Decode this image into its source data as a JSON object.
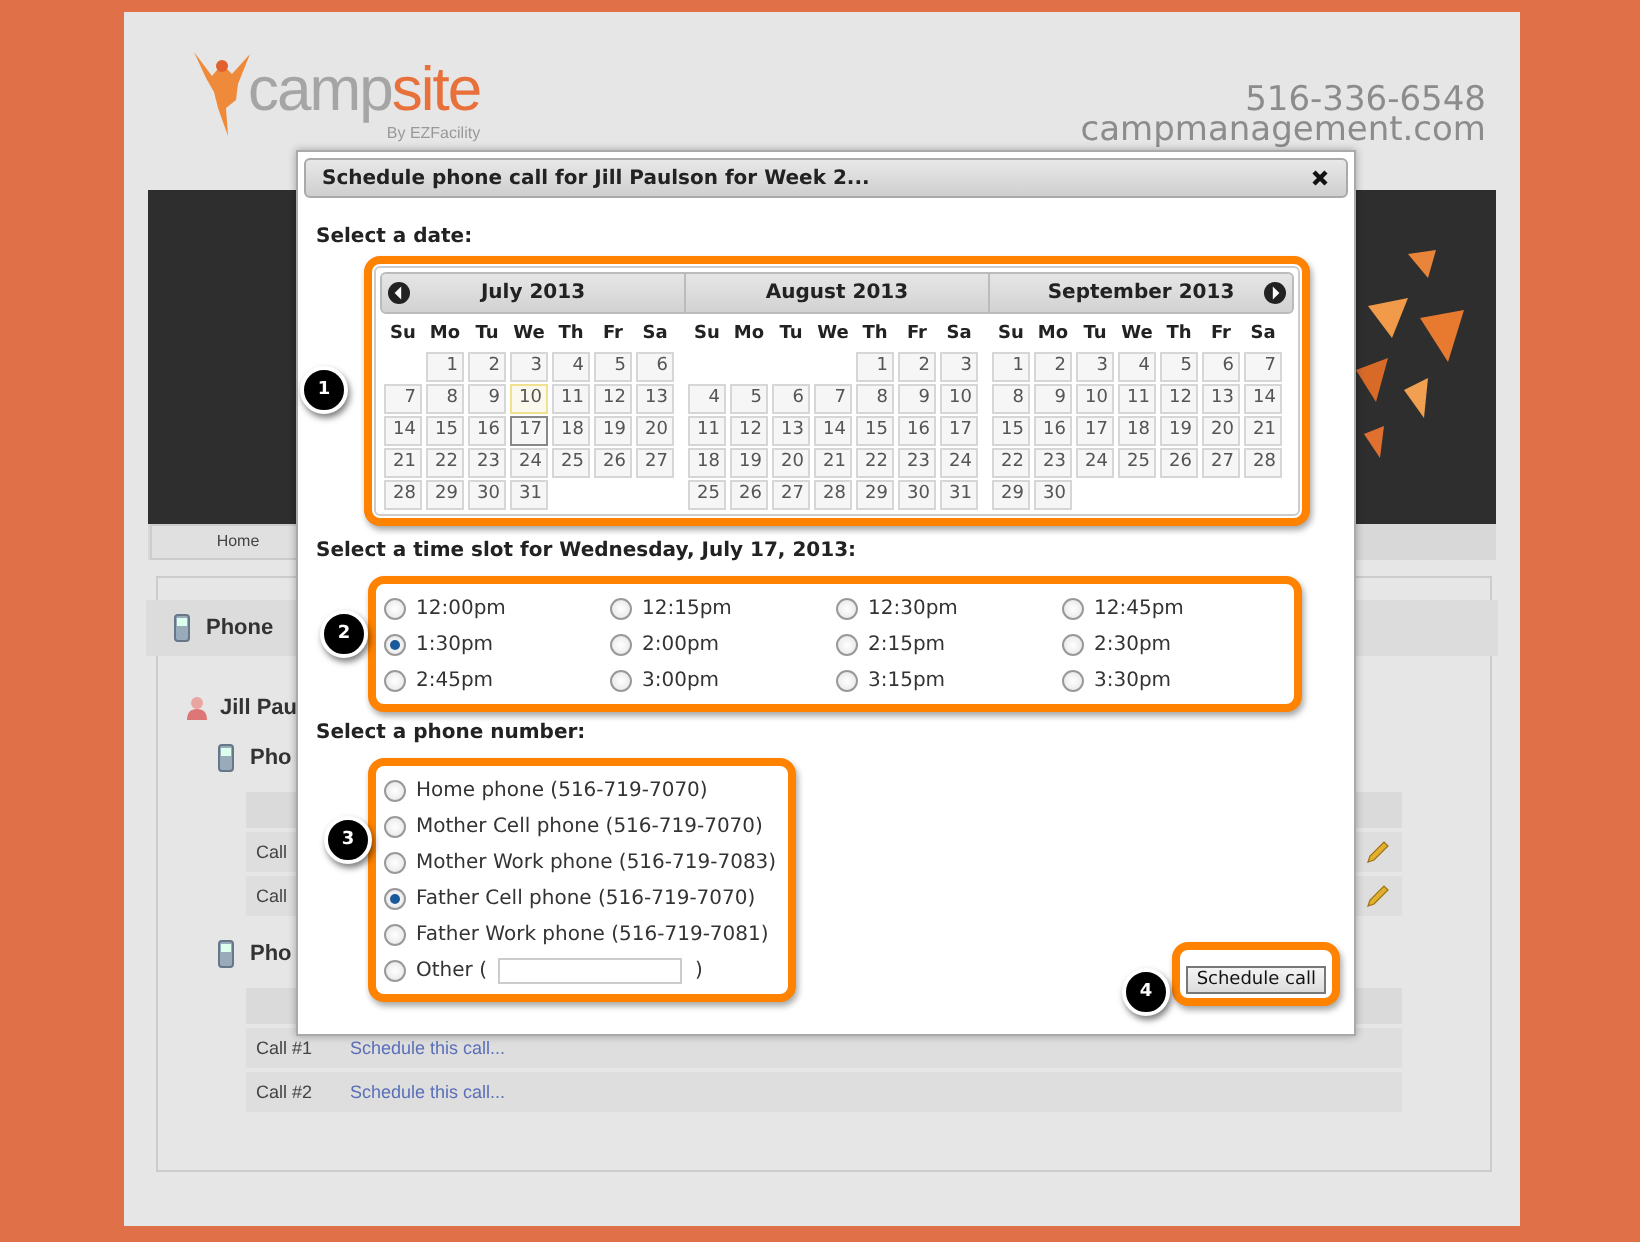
{
  "header": {
    "logo_text": "camp",
    "logo_accent": "site",
    "logo_byline": "By EZFacility",
    "phone": "516-336-6548",
    "website": "campmanagement.com"
  },
  "nav": {
    "item": "Home"
  },
  "background": {
    "section_title": "Phone",
    "person": "Jill Pau",
    "groups": [
      {
        "title": "Pho",
        "rows": [
          {
            "label": "Call",
            "editable": true
          },
          {
            "label": "Call",
            "editable": true
          }
        ]
      },
      {
        "title": "Pho",
        "rows": [
          {
            "label": "Call #1",
            "link": "Schedule this call...",
            "editable": false
          },
          {
            "label": "Call #2",
            "link": "Schedule this call...",
            "editable": false
          }
        ]
      }
    ]
  },
  "dialog": {
    "title": "Schedule phone call for Jill Paulson for Week 2...",
    "date_label": "Select a date:",
    "months": [
      {
        "title": "July 2013",
        "prev_button": true,
        "next_button": false,
        "weekdays": [
          "Su",
          "Mo",
          "Tu",
          "We",
          "Th",
          "Fr",
          "Sa"
        ],
        "weeks": [
          [
            {
              "kind": "blank"
            },
            {
              "kind": "day",
              "label": "1",
              "selected": false,
              "today": false
            },
            {
              "kind": "day",
              "label": "2",
              "selected": false,
              "today": false
            },
            {
              "kind": "day",
              "label": "3",
              "selected": false,
              "today": false
            },
            {
              "kind": "day",
              "label": "4",
              "selected": false,
              "today": false
            },
            {
              "kind": "day",
              "label": "5",
              "selected": false,
              "today": false
            },
            {
              "kind": "day",
              "label": "6",
              "selected": false,
              "today": false
            }
          ],
          [
            {
              "kind": "day",
              "label": "7",
              "selected": false,
              "today": false
            },
            {
              "kind": "day",
              "label": "8",
              "selected": false,
              "today": false
            },
            {
              "kind": "day",
              "label": "9",
              "selected": false,
              "today": false
            },
            {
              "kind": "day",
              "label": "10",
              "selected": false,
              "today": true
            },
            {
              "kind": "day",
              "label": "11",
              "selected": false,
              "today": false
            },
            {
              "kind": "day",
              "label": "12",
              "selected": false,
              "today": false
            },
            {
              "kind": "day",
              "label": "13",
              "selected": false,
              "today": false
            }
          ],
          [
            {
              "kind": "day",
              "label": "14",
              "selected": false,
              "today": false
            },
            {
              "kind": "day",
              "label": "15",
              "selected": false,
              "today": false
            },
            {
              "kind": "day",
              "label": "16",
              "selected": false,
              "today": false
            },
            {
              "kind": "day",
              "label": "17",
              "selected": true,
              "today": false
            },
            {
              "kind": "day",
              "label": "18",
              "selected": false,
              "today": false
            },
            {
              "kind": "day",
              "label": "19",
              "selected": false,
              "today": false
            },
            {
              "kind": "day",
              "label": "20",
              "selected": false,
              "today": false
            }
          ],
          [
            {
              "kind": "day",
              "label": "21",
              "selected": false,
              "today": false
            },
            {
              "kind": "day",
              "label": "22",
              "selected": false,
              "today": false
            },
            {
              "kind": "day",
              "label": "23",
              "selected": false,
              "today": false
            },
            {
              "kind": "day",
              "label": "24",
              "selected": false,
              "today": false
            },
            {
              "kind": "day",
              "label": "25",
              "selected": false,
              "today": false
            },
            {
              "kind": "day",
              "label": "26",
              "selected": false,
              "today": false
            },
            {
              "kind": "day",
              "label": "27",
              "selected": false,
              "today": false
            }
          ],
          [
            {
              "kind": "day",
              "label": "28",
              "selected": false,
              "today": false
            },
            {
              "kind": "day",
              "label": "29",
              "selected": false,
              "today": false
            },
            {
              "kind": "day",
              "label": "30",
              "selected": false,
              "today": false
            },
            {
              "kind": "day",
              "label": "31",
              "selected": false,
              "today": false
            }
          ]
        ]
      },
      {
        "title": "August 2013",
        "prev_button": false,
        "next_button": false,
        "weekdays": [
          "Su",
          "Mo",
          "Tu",
          "We",
          "Th",
          "Fr",
          "Sa"
        ],
        "weeks": [
          [
            {
              "kind": "blank"
            },
            {
              "kind": "blank"
            },
            {
              "kind": "blank"
            },
            {
              "kind": "blank"
            },
            {
              "kind": "day",
              "label": "1",
              "selected": false,
              "today": false
            },
            {
              "kind": "day",
              "label": "2",
              "selected": false,
              "today": false
            },
            {
              "kind": "day",
              "label": "3",
              "selected": false,
              "today": false
            }
          ],
          [
            {
              "kind": "day",
              "label": "4",
              "selected": false,
              "today": false
            },
            {
              "kind": "day",
              "label": "5",
              "selected": false,
              "today": false
            },
            {
              "kind": "day",
              "label": "6",
              "selected": false,
              "today": false
            },
            {
              "kind": "day",
              "label": "7",
              "selected": false,
              "today": false
            },
            {
              "kind": "day",
              "label": "8",
              "selected": false,
              "today": false
            },
            {
              "kind": "day",
              "label": "9",
              "selected": false,
              "today": false
            },
            {
              "kind": "day",
              "label": "10",
              "selected": false,
              "today": false
            }
          ],
          [
            {
              "kind": "day",
              "label": "11",
              "selected": false,
              "today": false
            },
            {
              "kind": "day",
              "label": "12",
              "selected": false,
              "today": false
            },
            {
              "kind": "day",
              "label": "13",
              "selected": false,
              "today": false
            },
            {
              "kind": "day",
              "label": "14",
              "selected": false,
              "today": false
            },
            {
              "kind": "day",
              "label": "15",
              "selected": false,
              "today": false
            },
            {
              "kind": "day",
              "label": "16",
              "selected": false,
              "today": false
            },
            {
              "kind": "day",
              "label": "17",
              "selected": false,
              "today": false
            }
          ],
          [
            {
              "kind": "day",
              "label": "18",
              "selected": false,
              "today": false
            },
            {
              "kind": "day",
              "label": "19",
              "selected": false,
              "today": false
            },
            {
              "kind": "day",
              "label": "20",
              "selected": false,
              "today": false
            },
            {
              "kind": "day",
              "label": "21",
              "selected": false,
              "today": false
            },
            {
              "kind": "day",
              "label": "22",
              "selected": false,
              "today": false
            },
            {
              "kind": "day",
              "label": "23",
              "selected": false,
              "today": false
            },
            {
              "kind": "day",
              "label": "24",
              "selected": false,
              "today": false
            }
          ],
          [
            {
              "kind": "day",
              "label": "25",
              "selected": false,
              "today": false
            },
            {
              "kind": "day",
              "label": "26",
              "selected": false,
              "today": false
            },
            {
              "kind": "day",
              "label": "27",
              "selected": false,
              "today": false
            },
            {
              "kind": "day",
              "label": "28",
              "selected": false,
              "today": false
            },
            {
              "kind": "day",
              "label": "29",
              "selected": false,
              "today": false
            },
            {
              "kind": "day",
              "label": "30",
              "selected": false,
              "today": false
            },
            {
              "kind": "day",
              "label": "31",
              "selected": false,
              "today": false
            }
          ]
        ]
      },
      {
        "title": "September 2013",
        "prev_button": false,
        "next_button": true,
        "weekdays": [
          "Su",
          "Mo",
          "Tu",
          "We",
          "Th",
          "Fr",
          "Sa"
        ],
        "weeks": [
          [
            {
              "kind": "day",
              "label": "1",
              "selected": false,
              "today": false
            },
            {
              "kind": "day",
              "label": "2",
              "selected": false,
              "today": false
            },
            {
              "kind": "day",
              "label": "3",
              "selected": false,
              "today": false
            },
            {
              "kind": "day",
              "label": "4",
              "selected": false,
              "today": false
            },
            {
              "kind": "day",
              "label": "5",
              "selected": false,
              "today": false
            },
            {
              "kind": "day",
              "label": "6",
              "selected": false,
              "today": false
            },
            {
              "kind": "day",
              "label": "7",
              "selected": false,
              "today": false
            }
          ],
          [
            {
              "kind": "day",
              "label": "8",
              "selected": false,
              "today": false
            },
            {
              "kind": "day",
              "label": "9",
              "selected": false,
              "today": false
            },
            {
              "kind": "day",
              "label": "10",
              "selected": false,
              "today": false
            },
            {
              "kind": "day",
              "label": "11",
              "selected": false,
              "today": false
            },
            {
              "kind": "day",
              "label": "12",
              "selected": false,
              "today": false
            },
            {
              "kind": "day",
              "label": "13",
              "selected": false,
              "today": false
            },
            {
              "kind": "day",
              "label": "14",
              "selected": false,
              "today": false
            }
          ],
          [
            {
              "kind": "day",
              "label": "15",
              "selected": false,
              "today": false
            },
            {
              "kind": "day",
              "label": "16",
              "selected": false,
              "today": false
            },
            {
              "kind": "day",
              "label": "17",
              "selected": false,
              "today": false
            },
            {
              "kind": "day",
              "label": "18",
              "selected": false,
              "today": false
            },
            {
              "kind": "day",
              "label": "19",
              "selected": false,
              "today": false
            },
            {
              "kind": "day",
              "label": "20",
              "selected": false,
              "today": false
            },
            {
              "kind": "day",
              "label": "21",
              "selected": false,
              "today": false
            }
          ],
          [
            {
              "kind": "day",
              "label": "22",
              "selected": false,
              "today": false
            },
            {
              "kind": "day",
              "label": "23",
              "selected": false,
              "today": false
            },
            {
              "kind": "day",
              "label": "24",
              "selected": false,
              "today": false
            },
            {
              "kind": "day",
              "label": "25",
              "selected": false,
              "today": false
            },
            {
              "kind": "day",
              "label": "26",
              "selected": false,
              "today": false
            },
            {
              "kind": "day",
              "label": "27",
              "selected": false,
              "today": false
            },
            {
              "kind": "day",
              "label": "28",
              "selected": false,
              "today": false
            }
          ],
          [
            {
              "kind": "day",
              "label": "29",
              "selected": false,
              "today": false
            },
            {
              "kind": "day",
              "label": "30",
              "selected": false,
              "today": false
            }
          ]
        ]
      }
    ],
    "time_label": "Select a time slot for Wednesday, July 17, 2013:",
    "time_slots": [
      {
        "label": "12:00pm",
        "selected": false
      },
      {
        "label": "12:15pm",
        "selected": false
      },
      {
        "label": "12:30pm",
        "selected": false
      },
      {
        "label": "12:45pm",
        "selected": false
      },
      {
        "label": "1:30pm",
        "selected": true
      },
      {
        "label": "2:00pm",
        "selected": false
      },
      {
        "label": "2:15pm",
        "selected": false
      },
      {
        "label": "2:30pm",
        "selected": false
      },
      {
        "label": "2:45pm",
        "selected": false
      },
      {
        "label": "3:00pm",
        "selected": false
      },
      {
        "label": "3:15pm",
        "selected": false
      },
      {
        "label": "3:30pm",
        "selected": false
      }
    ],
    "phone_label": "Select a phone number:",
    "phone_options": [
      {
        "kind": "preset",
        "label": "Home phone (516-719-7070)",
        "selected": false
      },
      {
        "kind": "preset",
        "label": "Mother Cell phone (516-719-7070)",
        "selected": false
      },
      {
        "kind": "preset",
        "label": "Mother Work phone (516-719-7083)",
        "selected": false
      },
      {
        "kind": "preset",
        "label": "Father Cell phone (516-719-7070)",
        "selected": true
      },
      {
        "kind": "preset",
        "label": "Father Work phone (516-719-7081)",
        "selected": false
      },
      {
        "kind": "other",
        "label": "Other (",
        "suffix": ")",
        "selected": false
      }
    ],
    "button": "Schedule call"
  },
  "callouts": [
    "1",
    "2",
    "3",
    "4"
  ]
}
